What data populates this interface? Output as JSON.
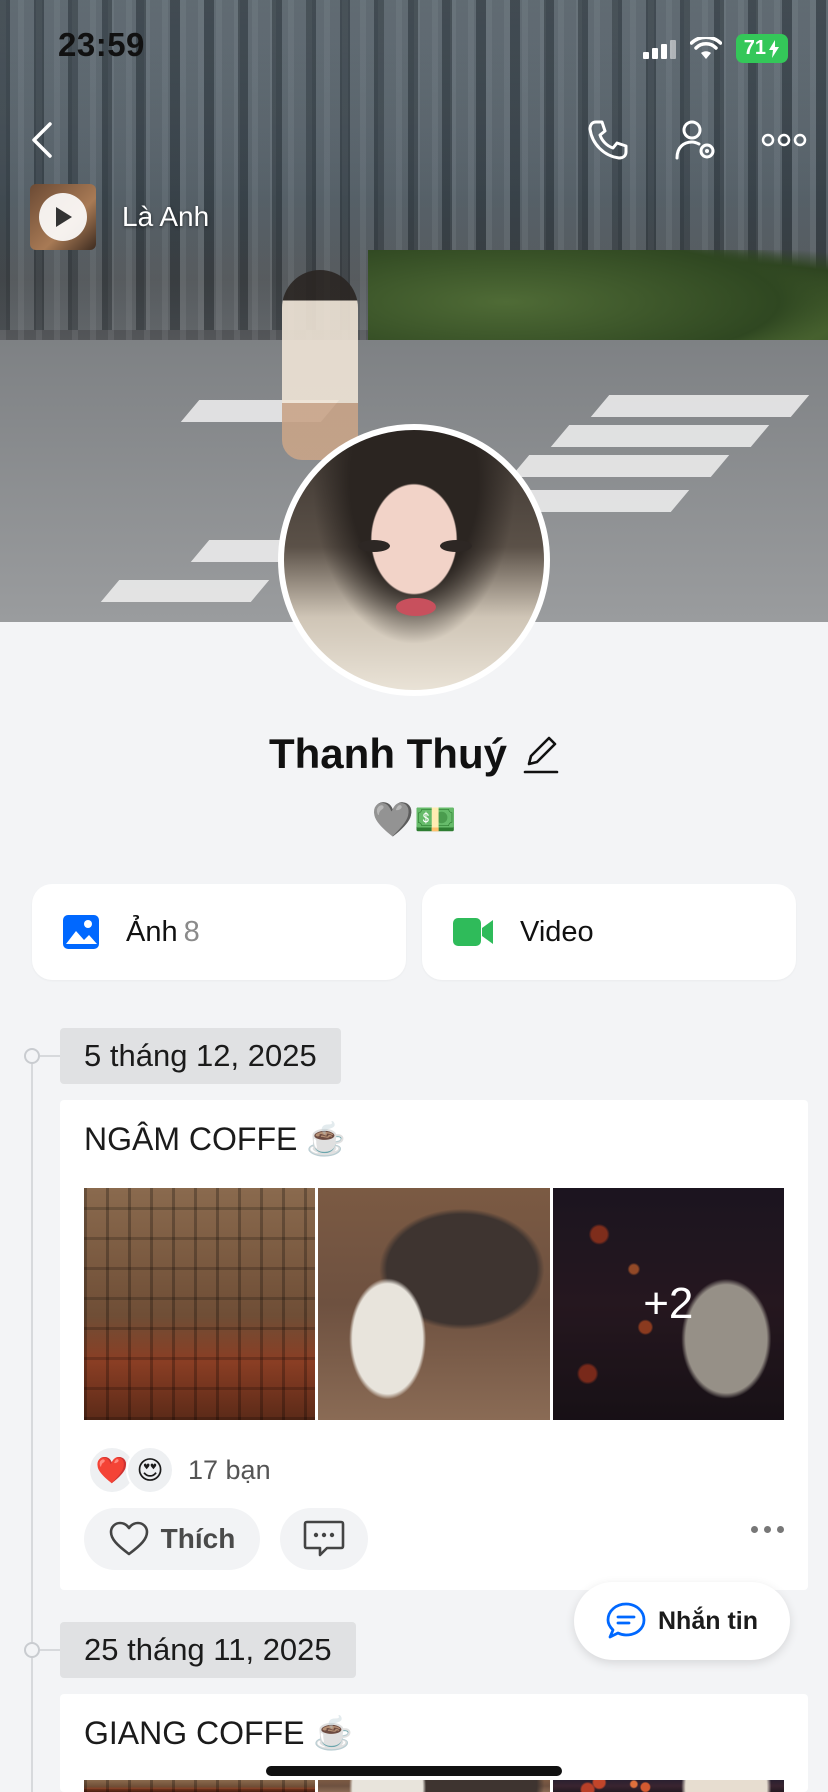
{
  "status_bar": {
    "time": "23:59",
    "battery": "71"
  },
  "music": {
    "title": "Là Anh"
  },
  "profile": {
    "name": "Thanh Thuý",
    "bio": "🩶💵"
  },
  "media_buttons": {
    "photos_label": "Ảnh",
    "photos_count": "8",
    "video_label": "Video"
  },
  "posts": [
    {
      "date": "5 tháng 12, 2025",
      "title": "NGÂM COFFE ☕️",
      "more_photos": "+2",
      "reactions": [
        "❤️",
        "😍"
      ],
      "reaction_count": "17 bạn",
      "like_label": "Thích"
    },
    {
      "date": "25 tháng 11, 2025",
      "title": "GIANG COFFE ☕️"
    }
  ],
  "chat_button": {
    "label": "Nhắn tin"
  },
  "colors": {
    "accent_blue": "#0068ff",
    "video_green": "#2fbb5a",
    "battery_green": "#34c759"
  }
}
